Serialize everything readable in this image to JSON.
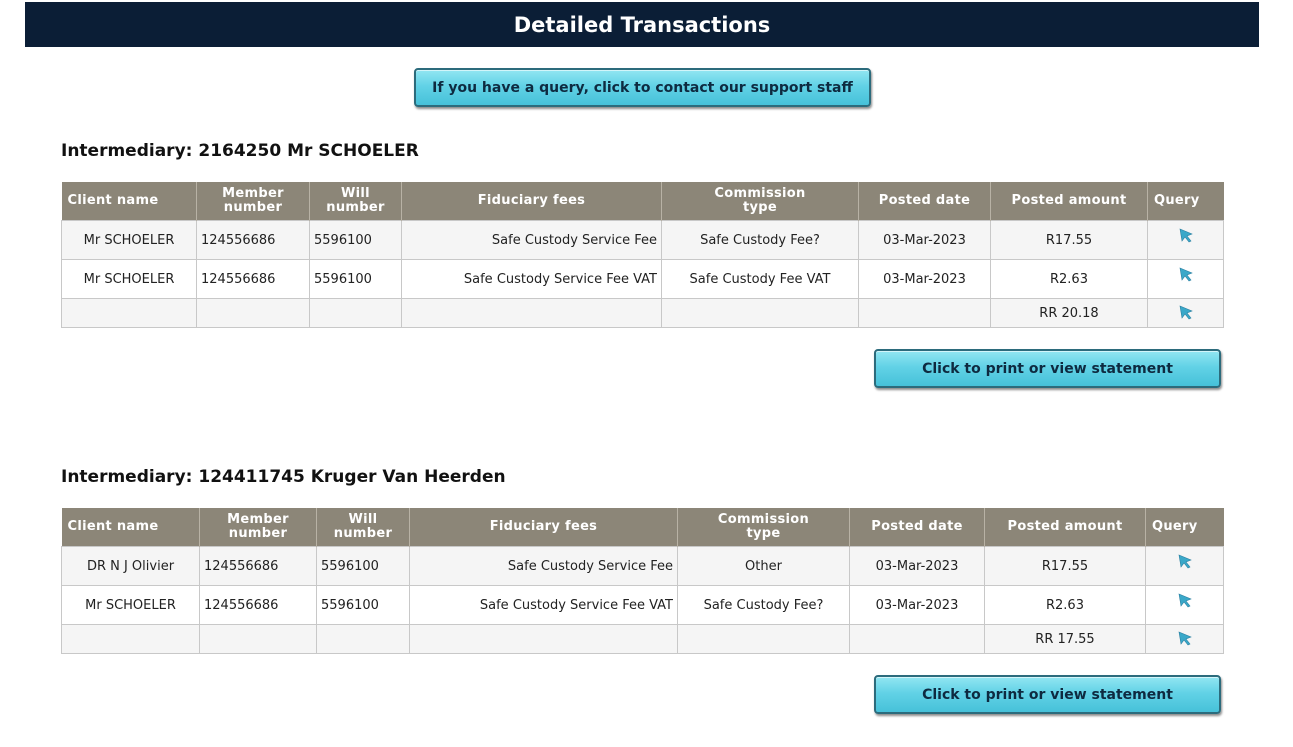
{
  "header": {
    "title": "Detailed Transactions"
  },
  "query_button": {
    "label": "If you have a query, click to contact our support staff"
  },
  "columns": {
    "client_name": "Client name",
    "member_number_1": "Member",
    "member_number_2": "number",
    "will_number_1": "Will",
    "will_number_2": "number",
    "fiduciary_fees": "Fiduciary fees",
    "commission_type_1": "Commission",
    "commission_type_2": "type",
    "posted_date": "Posted date",
    "posted_amount": "Posted amount",
    "query": "Query"
  },
  "icons": {
    "query": "cursor-arrow-icon",
    "query_color": "#3aa8c9"
  },
  "sections": [
    {
      "title": "Intermediary: 2164250 Mr SCHOELER",
      "rows": [
        {
          "client": "Mr SCHOELER",
          "member": "124556686",
          "will": "5596100",
          "fee": "Safe Custody Service Fee",
          "commission": "Safe Custody Fee?",
          "date": "03-Mar-2023",
          "amount": "R17.55"
        },
        {
          "client": "Mr SCHOELER",
          "member": "124556686",
          "will": "5596100",
          "fee": "Safe Custody Service Fee VAT",
          "commission": "Safe Custody Fee VAT",
          "date": "03-Mar-2023",
          "amount": "R2.63"
        }
      ],
      "total": "RR 20.18",
      "print_label": "Click to print or view statement"
    },
    {
      "title": "Intermediary: 124411745 Kruger Van Heerden",
      "rows": [
        {
          "client": "DR N J Olivier",
          "member": "124556686",
          "will": "5596100",
          "fee": "Safe Custody Service Fee",
          "commission": "Other",
          "date": "03-Mar-2023",
          "amount": "R17.55"
        },
        {
          "client": "Mr SCHOELER",
          "member": "124556686",
          "will": "5596100",
          "fee": "Safe Custody Service Fee VAT",
          "commission": "Safe Custody Fee?",
          "date": "03-Mar-2023",
          "amount": "R2.63"
        }
      ],
      "total": "RR 17.55",
      "print_label": "Click to print or view statement"
    }
  ]
}
